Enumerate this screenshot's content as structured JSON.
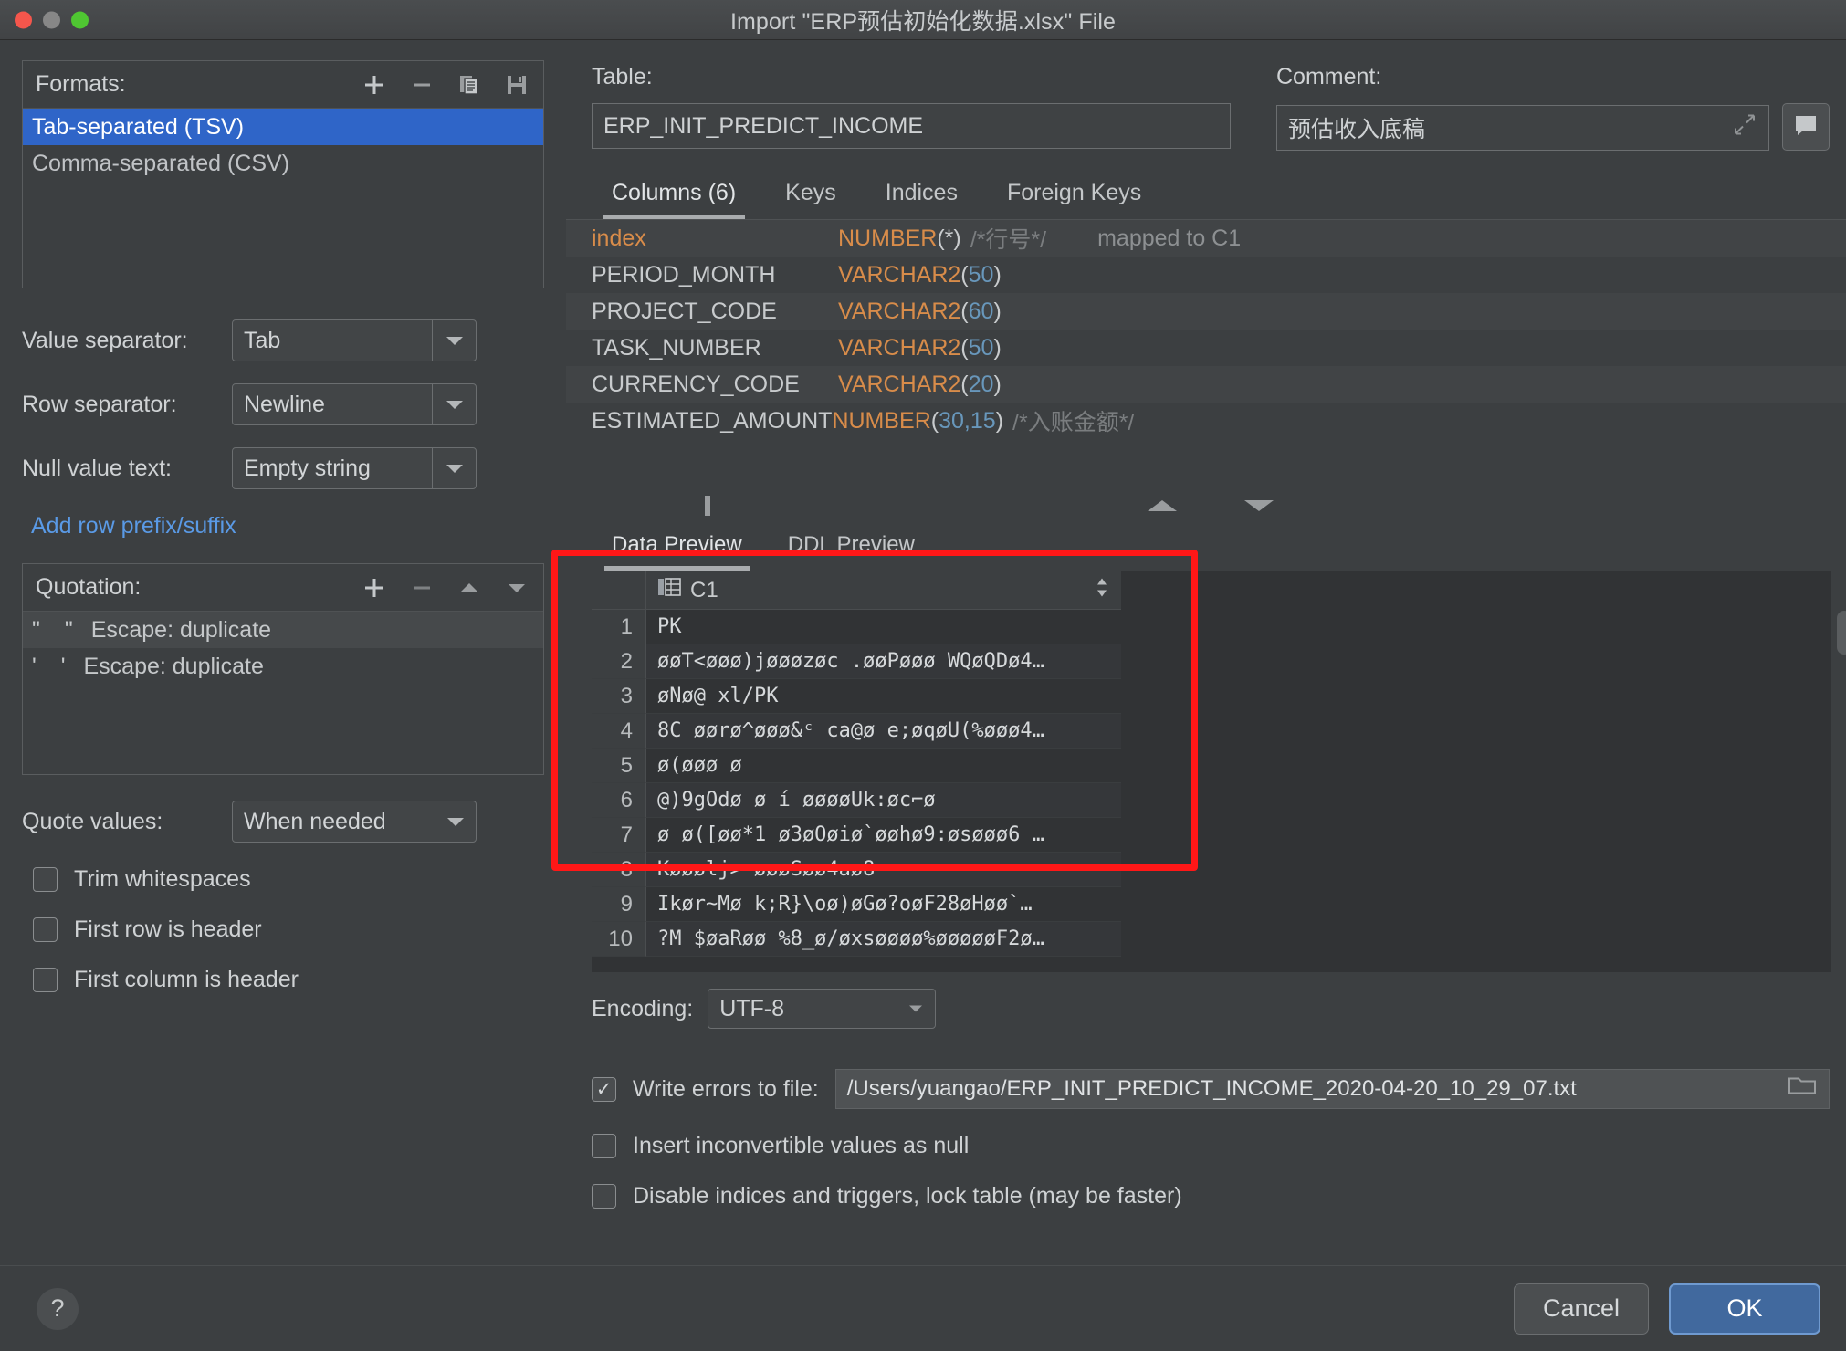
{
  "window": {
    "title": "Import \"ERP预估初始化数据.xlsx\" File",
    "traffic_lights": [
      "close",
      "minimize",
      "zoom"
    ]
  },
  "formats": {
    "label": "Formats:",
    "toolbar": [
      {
        "name": "add-format-button",
        "icon": "plus-icon"
      },
      {
        "name": "remove-format-button",
        "icon": "minus-icon"
      },
      {
        "name": "copy-format-button",
        "icon": "copy-icon"
      },
      {
        "name": "save-format-button",
        "icon": "save-icon"
      }
    ],
    "items": [
      {
        "label": "Tab-separated (TSV)",
        "selected": true
      },
      {
        "label": "Comma-separated (CSV)",
        "selected": false
      }
    ]
  },
  "settings": {
    "value_separator": {
      "label": "Value separator:",
      "value": "Tab"
    },
    "row_separator": {
      "label": "Row separator:",
      "value": "Newline"
    },
    "null_value_text": {
      "label": "Null value text:",
      "value": "Empty string"
    },
    "add_row_prefix_link": "Add row prefix/suffix",
    "quote_values": {
      "label": "Quote values:",
      "value": "When needed"
    }
  },
  "quotation": {
    "label": "Quotation:",
    "toolbar": [
      {
        "name": "add-quotation-button",
        "icon": "plus-icon"
      },
      {
        "name": "remove-quotation-button",
        "icon": "minus-icon"
      },
      {
        "name": "move-up-button",
        "icon": "triangle-up-icon"
      },
      {
        "name": "move-down-button",
        "icon": "triangle-down-icon"
      }
    ],
    "items": [
      {
        "quote": "\"   \"",
        "escape": "Escape: duplicate"
      },
      {
        "quote": "'   '",
        "escape": "Escape: duplicate"
      }
    ]
  },
  "left_checkboxes": [
    {
      "label": "Trim whitespaces",
      "checked": false
    },
    {
      "label": "First row is header",
      "checked": false
    },
    {
      "label": "First column is header",
      "checked": false
    }
  ],
  "table_field": {
    "label": "Table:",
    "value": "ERP_INIT_PREDICT_INCOME"
  },
  "comment_field": {
    "label": "Comment:",
    "value": "预估收入底稿",
    "expand_icon": "expand-diagonal-icon",
    "button_icon": "comment-bubble-icon"
  },
  "structure_tabs": [
    {
      "label": "Columns (6)",
      "active": true
    },
    {
      "label": "Keys",
      "active": false
    },
    {
      "label": "Indices",
      "active": false
    },
    {
      "label": "Foreign Keys",
      "active": false
    }
  ],
  "columns": [
    {
      "name": "index",
      "name_style": "idx",
      "type": "NUMBER",
      "size": "*",
      "comment": "/*行号*/",
      "mapped": "mapped to C1"
    },
    {
      "name": "PERIOD_MONTH",
      "name_style": "plain",
      "type": "VARCHAR2",
      "size": "50",
      "comment": "",
      "mapped": ""
    },
    {
      "name": "PROJECT_CODE",
      "name_style": "plain",
      "type": "VARCHAR2",
      "size": "60",
      "comment": "",
      "mapped": ""
    },
    {
      "name": "TASK_NUMBER",
      "name_style": "plain",
      "type": "VARCHAR2",
      "size": "50",
      "comment": "",
      "mapped": ""
    },
    {
      "name": "CURRENCY_CODE",
      "name_style": "plain",
      "type": "VARCHAR2",
      "size": "20",
      "comment": "",
      "mapped": ""
    },
    {
      "name": "ESTIMATED_AMOUNT",
      "name_style": "plain",
      "type": "NUMBER",
      "size": "30,15",
      "comment": "/*入账金额*/",
      "mapped": ""
    }
  ],
  "preview": {
    "tabs": [
      {
        "label": "Data Preview",
        "active": true
      },
      {
        "label": "DDL Preview",
        "active": false
      }
    ],
    "column_header": {
      "label": "C1",
      "icon": "table-column-icon",
      "sort_icon": "sort-updown-icon"
    },
    "rows": [
      {
        "n": "1",
        "value": "PK"
      },
      {
        "n": "2",
        "value": "øøT<øøø)jøøøzøc .øøPøøø WQøQDø4…"
      },
      {
        "n": "3",
        "value": "øNø@ xl/PK"
      },
      {
        "n": "4",
        "value": "8C øørø^øøø&ᶜ ca@ø e;øqøU(%øøø4…"
      },
      {
        "n": "5",
        "value": " ø(øøø ø"
      },
      {
        "n": "6",
        "value": "@)9gOdø ø í øøøøUk:øc⌐ø"
      },
      {
        "n": "7",
        "value": "ø ø([øø*1 ø3øOøiø`øøhø9:øsøøø6 …"
      },
      {
        "n": "8",
        "value": "Køøølj> øøøSøø4aø8"
      },
      {
        "n": "9",
        "value": "Ikør~Mø k;R}\\oø)øGø?oøF28øHøø`…"
      },
      {
        "n": "10",
        "value": "?M $øaRøø %8_ø/øxsøøøø%øøøøøF2ø…"
      }
    ]
  },
  "encoding": {
    "label": "Encoding:",
    "value": "UTF-8"
  },
  "bottom_options": [
    {
      "label": "Write errors to file:",
      "checked": true,
      "has_path": true,
      "path": "/Users/yuangao/ERP_INIT_PREDICT_INCOME_2020-04-20_10_29_07.txt"
    },
    {
      "label": "Insert inconvertible values as null",
      "checked": false,
      "has_path": false,
      "path": ""
    },
    {
      "label": "Disable indices and triggers, lock table (may be faster)",
      "checked": false,
      "has_path": false,
      "path": ""
    }
  ],
  "footer": {
    "help_label": "?",
    "cancel_label": "Cancel",
    "ok_label": "OK"
  },
  "colors": {
    "accent_selection": "#2f65c8",
    "ok_button": "#41699e",
    "link": "#5a9ae6",
    "type_orange": "#d88c4a",
    "number_blue": "#6897bb",
    "annotation_red": "#ff1717"
  }
}
